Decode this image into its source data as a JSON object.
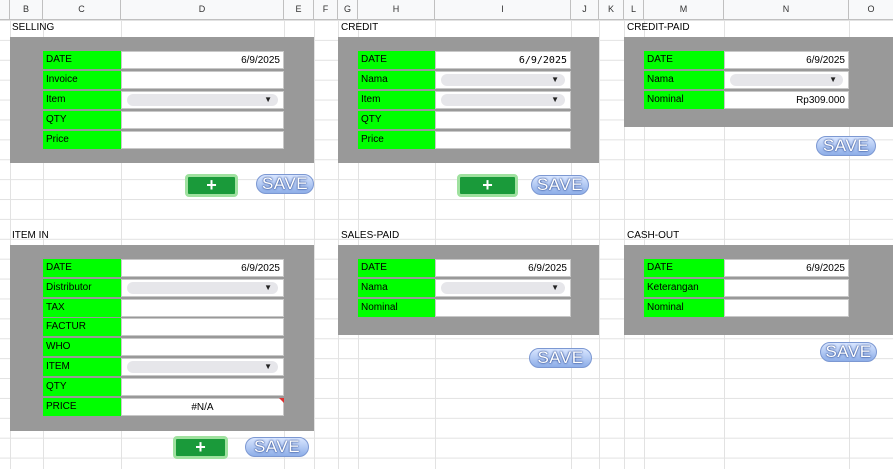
{
  "columns": [
    "B",
    "C",
    "D",
    "E",
    "F",
    "G",
    "H",
    "I",
    "J",
    "K",
    "L",
    "M",
    "N",
    "O"
  ],
  "colors": {
    "label_bg": "#00ff00",
    "panel_bg": "#999999",
    "save_button": "#8eaee8",
    "add_button": "#1a9a3a"
  },
  "selling": {
    "title": "SELLING",
    "fields": [
      {
        "label": "DATE",
        "value": "6/9/2025"
      },
      {
        "label": "Invoice",
        "value": ""
      },
      {
        "label": "Item",
        "value": ""
      },
      {
        "label": "QTY",
        "value": ""
      },
      {
        "label": "Price",
        "value": ""
      }
    ],
    "add_label": "+",
    "save_label": "SAVE"
  },
  "credit": {
    "title": "CREDIT",
    "fields": [
      {
        "label": "DATE",
        "value": "6/9/2025"
      },
      {
        "label": "Nama",
        "value": ""
      },
      {
        "label": "Item",
        "value": ""
      },
      {
        "label": "QTY",
        "value": ""
      },
      {
        "label": "Price",
        "value": ""
      }
    ],
    "add_label": "+",
    "save_label": "SAVE"
  },
  "credit_paid": {
    "title": "CREDIT-PAID",
    "fields": [
      {
        "label": "DATE",
        "value": "6/9/2025"
      },
      {
        "label": "Nama",
        "value": ""
      },
      {
        "label": "Nominal",
        "value": "Rp309.000"
      }
    ],
    "save_label": "SAVE"
  },
  "item_in": {
    "title": "ITEM IN",
    "fields": [
      {
        "label": "DATE",
        "value": "6/9/2025"
      },
      {
        "label": "Distributor",
        "value": ""
      },
      {
        "label": "TAX",
        "value": ""
      },
      {
        "label": "FACTUR",
        "value": ""
      },
      {
        "label": "WHO",
        "value": ""
      },
      {
        "label": "ITEM",
        "value": ""
      },
      {
        "label": "QTY",
        "value": ""
      },
      {
        "label": "PRICE",
        "value": "#N/A"
      }
    ],
    "add_label": "+",
    "save_label": "SAVE"
  },
  "sales_paid": {
    "title": "SALES-PAID",
    "fields": [
      {
        "label": "DATE",
        "value": "6/9/2025"
      },
      {
        "label": "Nama",
        "value": ""
      },
      {
        "label": "Nominal",
        "value": ""
      }
    ],
    "save_label": "SAVE"
  },
  "cash_out": {
    "title": "CASH-OUT",
    "fields": [
      {
        "label": "DATE",
        "value": "6/9/2025"
      },
      {
        "label": "Keterangan",
        "value": ""
      },
      {
        "label": "Nominal",
        "value": ""
      }
    ],
    "save_label": "SAVE"
  }
}
